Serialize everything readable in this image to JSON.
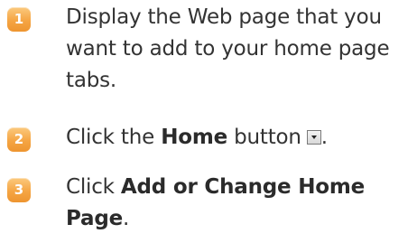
{
  "steps": [
    {
      "number": "1",
      "text": "Display the Web page that you want to add to your home page tabs."
    },
    {
      "number": "2",
      "prefix": "Click the ",
      "bold": "Home",
      "suffix_before_icon": " button",
      "icon": "dropdown-arrow-icon",
      "suffix_after_icon": "."
    },
    {
      "number": "3",
      "prefix": "Click ",
      "bold": "Add or Change Home Page",
      "suffix": "."
    }
  ],
  "colors": {
    "badge": "#f5a544",
    "text": "#333333"
  }
}
